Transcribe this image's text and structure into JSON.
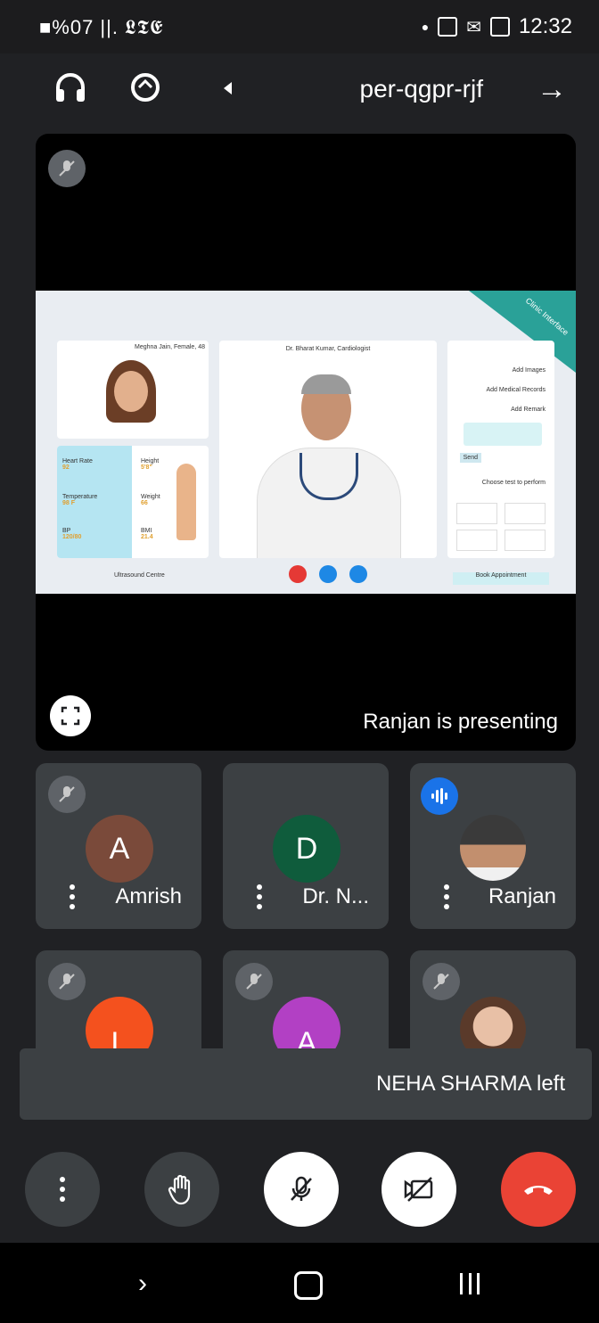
{
  "status_bar": {
    "left_text": "■%07 ||. 𝕷𝕿𝕰",
    "time": "12:32"
  },
  "header": {
    "meeting_code": "per-qgpr-rjf",
    "icons": [
      "back-arrow-icon",
      "switch-camera-icon",
      "headphones-icon"
    ]
  },
  "presentation": {
    "presenting_text": "Ranjan is presenting",
    "slide": {
      "corner_banner": "Clinic Interface",
      "patient_label": "Meghna Jain, Female, 48",
      "doctor_label": "Dr. Bharat Kumar, Cardiologist",
      "vitals": [
        {
          "label": "Height",
          "value": "5'8\""
        },
        {
          "label": "Weight",
          "value": "66"
        },
        {
          "label": "BMI",
          "value": "21.4"
        },
        {
          "label": "Heart Rate",
          "value": "92"
        },
        {
          "label": "Temperature",
          "value": "98 F"
        },
        {
          "label": "BP",
          "value": "120/80"
        }
      ],
      "side_items": [
        "Add Images",
        "Add Medical Records",
        "Add Remark",
        "Send",
        "Choose test to perform"
      ],
      "buttons": [
        "Book Appointment",
        "Ultrasound Centre"
      ]
    }
  },
  "participants": [
    {
      "name": "Ranjan",
      "initial": "",
      "speaking": true,
      "muted": false,
      "color": ""
    },
    {
      "name": "Dr. N...",
      "initial": "D",
      "speaking": false,
      "muted": false,
      "color": "#0f5c3c"
    },
    {
      "name": "Amrish",
      "initial": "A",
      "speaking": false,
      "muted": true,
      "color": "#7a4a3a"
    },
    {
      "name": "",
      "initial": "",
      "speaking": false,
      "muted": true,
      "color": ""
    },
    {
      "name": "",
      "initial": "A",
      "speaking": false,
      "muted": true,
      "color": "#b240c4"
    },
    {
      "name": "",
      "initial": "L",
      "speaking": false,
      "muted": true,
      "color": "#f4511e"
    }
  ],
  "toast": {
    "text": "NEHA SHARMA left"
  },
  "controls": {
    "end_call": "end-call",
    "camera": "camera-off",
    "mic": "mic-off",
    "hand": "raise-hand",
    "more": "more-options"
  },
  "colors": {
    "end_call": "#ea4335",
    "speaking": "#1a73e8",
    "tile": "#3c4043",
    "background": "#202124"
  }
}
